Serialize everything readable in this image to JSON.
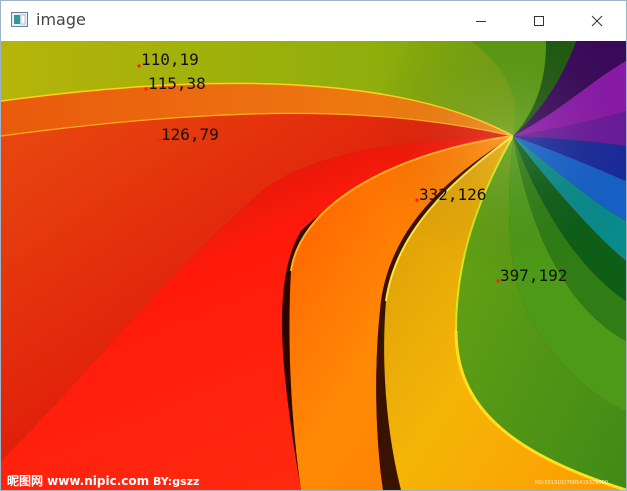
{
  "window": {
    "title": "image",
    "controls": {
      "minimize": "minimize",
      "maximize": "maximize",
      "close": "close"
    }
  },
  "image": {
    "points": [
      {
        "label": "110,19"
      },
      {
        "label": "115,38"
      },
      {
        "label": "126,79"
      },
      {
        "label": "332,126"
      },
      {
        "label": "397,192"
      }
    ],
    "watermark": {
      "left": "昵图网 www.nipic.com",
      "by": "BY:gszz",
      "id": "NO:20131027085415329000"
    },
    "colors": {
      "point_marker": "#ff2200",
      "label_text": "#111111"
    }
  }
}
